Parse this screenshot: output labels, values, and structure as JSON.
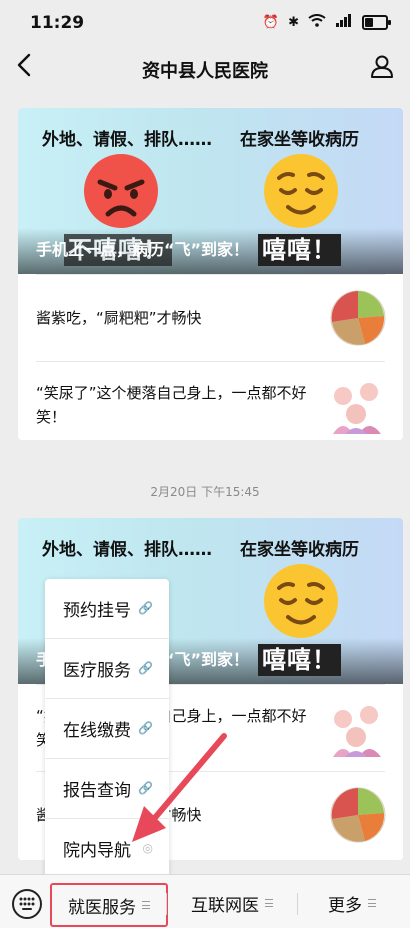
{
  "status_bar": {
    "time": "11:29"
  },
  "nav": {
    "title": "资中县人民医院"
  },
  "card1": {
    "banner_left": "外地、请假、排队……",
    "banner_right": "在家坐等收病历",
    "banner_headline": "手机上一点，病历“飞”到家！",
    "sticker_left": "不嘻嘻！",
    "sticker_right": "嘻嘻！",
    "articles": [
      {
        "title": "酱紫吃，“屙粑粑”才畅快"
      },
      {
        "title": "“笑尿了”这个梗落自己身上，一点都不好笑！"
      }
    ]
  },
  "timestamp": "2月20日 下午15:45",
  "card2": {
    "banner_left": "外地、请假、排队……",
    "banner_right": "在家坐等收病历",
    "banner_headline": "手机上一点，病历“飞”到家！",
    "sticker_right": "嘻嘻！",
    "articles": [
      {
        "title": "“笑尿了”这个梗落自己身上，一点都不好笑！"
      },
      {
        "title": "酱紫吃，“屙粑粑”才畅快"
      }
    ]
  },
  "popup_menu": {
    "items": [
      {
        "label": "预约挂号"
      },
      {
        "label": "医疗服务"
      },
      {
        "label": "在线缴费"
      },
      {
        "label": "报告查询"
      },
      {
        "label": "院内导航"
      }
    ]
  },
  "bottom_bar": {
    "tabs": [
      {
        "label": "就医服务"
      },
      {
        "label": "互联网医"
      },
      {
        "label": "更多"
      }
    ]
  },
  "colors": {
    "highlight": "#e8495a",
    "background": "#ededed"
  }
}
